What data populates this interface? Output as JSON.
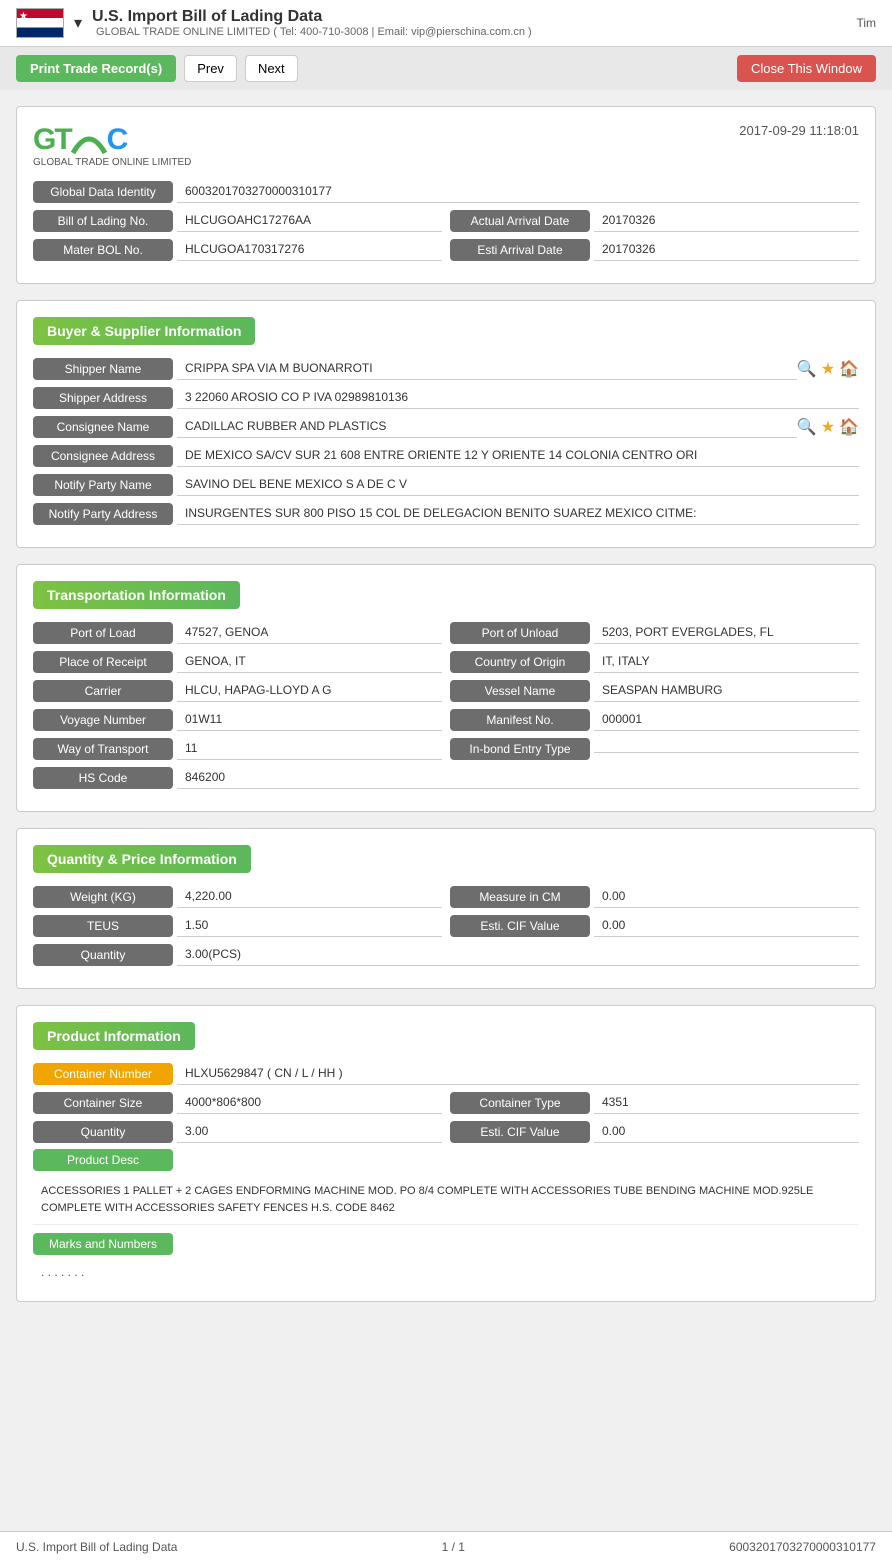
{
  "topbar": {
    "title": "U.S. Import Bill of Lading Data",
    "subtitle": "GLOBAL TRADE ONLINE LIMITED ( Tel: 400-710-3008 | Email: vip@pierschina.com.cn )",
    "right_text": "Tim"
  },
  "actions": {
    "print_label": "Print Trade Record(s)",
    "prev_label": "Prev",
    "next_label": "Next",
    "close_label": "Close This Window"
  },
  "header": {
    "timestamp": "2017-09-29 11:18:01",
    "logo_sub": "GLOBAL TRADE ONLINE LIMITED"
  },
  "identity": {
    "global_data_identity_label": "Global Data Identity",
    "global_data_identity_value": "6003201703270000310177",
    "bol_label": "Bill of Lading No.",
    "bol_value": "HLCUGOAHC17276AA",
    "actual_arrival_label": "Actual Arrival Date",
    "actual_arrival_value": "20170326",
    "master_bol_label": "Mater BOL No.",
    "master_bol_value": "HLCUGOA170317276",
    "esti_arrival_label": "Esti Arrival Date",
    "esti_arrival_value": "20170326"
  },
  "buyer_supplier": {
    "section_title": "Buyer & Supplier Information",
    "shipper_name_label": "Shipper Name",
    "shipper_name_value": "CRIPPA SPA VIA M BUONARROTI",
    "shipper_address_label": "Shipper Address",
    "shipper_address_value": "3 22060 AROSIO CO P IVA 02989810136",
    "consignee_name_label": "Consignee Name",
    "consignee_name_value": "CADILLAC RUBBER AND PLASTICS",
    "consignee_address_label": "Consignee Address",
    "consignee_address_value": "DE MEXICO SA/CV SUR 21 608 ENTRE ORIENTE 12 Y ORIENTE 14 COLONIA CENTRO ORI",
    "notify_party_name_label": "Notify Party Name",
    "notify_party_name_value": "SAVINO DEL BENE MEXICO S A DE C V",
    "notify_party_address_label": "Notify Party Address",
    "notify_party_address_value": "INSURGENTES SUR 800 PISO 15 COL DE DELEGACION BENITO SUAREZ MEXICO CITME:"
  },
  "transportation": {
    "section_title": "Transportation Information",
    "port_of_load_label": "Port of Load",
    "port_of_load_value": "47527, GENOA",
    "port_of_unload_label": "Port of Unload",
    "port_of_unload_value": "5203, PORT EVERGLADES, FL",
    "place_of_receipt_label": "Place of Receipt",
    "place_of_receipt_value": "GENOA, IT",
    "country_of_origin_label": "Country of Origin",
    "country_of_origin_value": "IT, ITALY",
    "carrier_label": "Carrier",
    "carrier_value": "HLCU, HAPAG-LLOYD A G",
    "vessel_name_label": "Vessel Name",
    "vessel_name_value": "SEASPAN HAMBURG",
    "voyage_number_label": "Voyage Number",
    "voyage_number_value": "01W11",
    "manifest_no_label": "Manifest No.",
    "manifest_no_value": "000001",
    "way_of_transport_label": "Way of Transport",
    "way_of_transport_value": "11",
    "inbond_entry_type_label": "In-bond Entry Type",
    "inbond_entry_type_value": "",
    "hs_code_label": "HS Code",
    "hs_code_value": "846200"
  },
  "quantity_price": {
    "section_title": "Quantity & Price Information",
    "weight_kg_label": "Weight (KG)",
    "weight_kg_value": "4,220.00",
    "measure_in_cm_label": "Measure in CM",
    "measure_in_cm_value": "0.00",
    "teus_label": "TEUS",
    "teus_value": "1.50",
    "esti_cif_value_label": "Esti. CIF Value",
    "esti_cif_value_value": "0.00",
    "quantity_label": "Quantity",
    "quantity_value": "3.00(PCS)"
  },
  "product": {
    "section_title": "Product Information",
    "container_number_label": "Container Number",
    "container_number_value": "HLXU5629847 ( CN / L / HH )",
    "container_size_label": "Container Size",
    "container_size_value": "4000*806*800",
    "container_type_label": "Container Type",
    "container_type_value": "4351",
    "quantity_label": "Quantity",
    "quantity_value": "3.00",
    "esti_cif_label": "Esti. CIF Value",
    "esti_cif_value": "0.00",
    "product_desc_label": "Product Desc",
    "product_desc_text": "ACCESSORIES 1 PALLET + 2 CAGES ENDFORMING MACHINE MOD. PO 8/4 COMPLETE WITH ACCESSORIES TUBE BENDING MACHINE MOD.925LE COMPLETE WITH ACCESSORIES SAFETY FENCES H.S. CODE 8462",
    "marks_numbers_label": "Marks and Numbers",
    "marks_numbers_value": ". . . . . . ."
  },
  "footer": {
    "left": "U.S. Import Bill of Lading Data",
    "center": "1 / 1",
    "right": "6003201703270000310177"
  }
}
